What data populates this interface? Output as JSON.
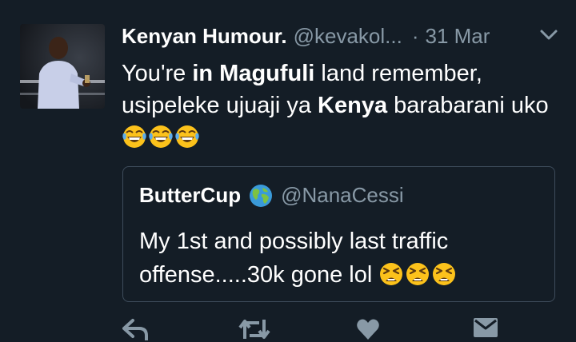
{
  "tweet": {
    "author": {
      "display_name": "Kenyan Humour.",
      "handle": "@kevakol...",
      "avatar": "avatar-photo"
    },
    "separator": "·",
    "date": "31 Mar",
    "menu_icon": "chevron-down-icon",
    "text": {
      "p1": "You're ",
      "b1": "in Magufuli",
      "p2": " land remember, usipeleke ujuaji ya ",
      "b2": "Kenya",
      "p3": " barabarani uko "
    },
    "emojis": [
      "tears-of-joy-emoji",
      "tears-of-joy-emoji",
      "tears-of-joy-emoji"
    ]
  },
  "quoted_tweet": {
    "display_name": "ButterCup",
    "name_icon": "globe-emoji",
    "handle": "@NanaCessi",
    "text": "My 1st and possibly last traffic offense.....30k gone lol ",
    "emojis": [
      "tired-face-emoji",
      "tired-face-emoji",
      "tired-face-emoji"
    ]
  },
  "actions": [
    "reply-icon",
    "retweet-icon",
    "like-icon",
    "message-icon"
  ],
  "colors": {
    "background": "#141d26",
    "primary_text": "#ffffff",
    "secondary_text": "#8899a6",
    "card_border": "#3e4c5b",
    "emoji_yellow": "#fcc21b"
  }
}
